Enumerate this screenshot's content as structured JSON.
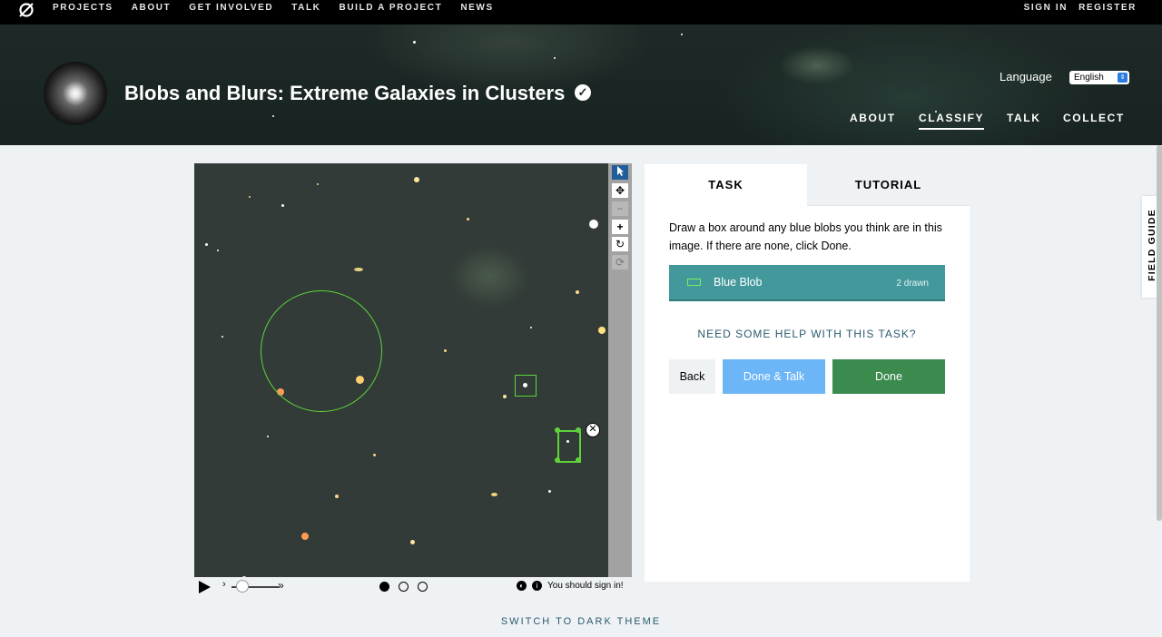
{
  "topbar": {
    "logo_icon": "zooniverse-logo-icon",
    "nav": [
      "PROJECTS",
      "ABOUT",
      "GET INVOLVED",
      "TALK",
      "BUILD A PROJECT",
      "NEWS"
    ],
    "sign_in": "SIGN IN",
    "register": "REGISTER"
  },
  "project": {
    "title": "Blobs and Blurs: Extreme Galaxies in Clusters",
    "verified_icon": "check-badge-icon",
    "language_label": "Language",
    "language_value": "English",
    "nav": [
      "ABOUT",
      "CLASSIFY",
      "TALK",
      "COLLECT"
    ],
    "active_nav": "CLASSIFY"
  },
  "subject_viewer": {
    "tools": [
      "pointer-icon",
      "pan-icon",
      "zoom-out-icon",
      "zoom-in-icon",
      "rotate-icon",
      "reset-icon"
    ],
    "delete_icon": "close-circle-icon",
    "frame_dots": 3,
    "active_frame": 1,
    "sign_in_note": "You should sign in!"
  },
  "task_panel": {
    "tab_task": "TASK",
    "tab_tutorial": "TUTORIAL",
    "instruction": "Draw a box around any blue blobs you think are in this image. If there are none, click Done.",
    "tool_label": "Blue Blob",
    "tool_count": "2 drawn",
    "help_link": "NEED SOME HELP WITH THIS TASK?",
    "back_label": "Back",
    "done_talk_label": "Done & Talk",
    "done_label": "Done"
  },
  "field_guide_label": "FIELD GUIDE",
  "theme_toggle": "SWITCH TO DARK THEME",
  "colors": {
    "answer": "#43989c",
    "done": "#3b8a4e",
    "done_talk": "#6cb5f6",
    "drawing": "#5dd33b"
  }
}
